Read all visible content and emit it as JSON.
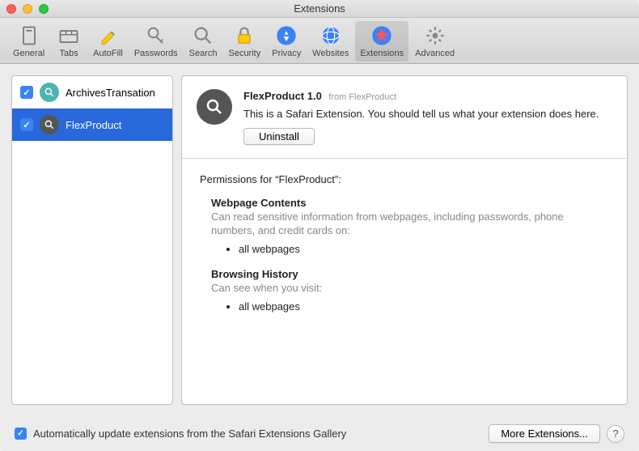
{
  "window": {
    "title": "Extensions"
  },
  "toolbar": {
    "items": [
      {
        "label": "General"
      },
      {
        "label": "Tabs"
      },
      {
        "label": "AutoFill"
      },
      {
        "label": "Passwords"
      },
      {
        "label": "Search"
      },
      {
        "label": "Security"
      },
      {
        "label": "Privacy"
      },
      {
        "label": "Websites"
      },
      {
        "label": "Extensions"
      },
      {
        "label": "Advanced"
      }
    ]
  },
  "sidebar": {
    "items": [
      {
        "label": "ArchivesTransation",
        "checked": true
      },
      {
        "label": "FlexProduct",
        "checked": true,
        "selected": true
      }
    ]
  },
  "detail": {
    "title": "FlexProduct 1.0",
    "from": "from FlexProduct",
    "description": "This is a Safari Extension. You should tell us what your extension does here.",
    "uninstall_label": "Uninstall"
  },
  "permissions": {
    "heading": "Permissions for “FlexProduct”:",
    "sections": [
      {
        "title": "Webpage Contents",
        "desc": "Can read sensitive information from webpages, including passwords, phone numbers, and credit cards on:",
        "items": [
          "all webpages"
        ]
      },
      {
        "title": "Browsing History",
        "desc": "Can see when you visit:",
        "items": [
          "all webpages"
        ]
      }
    ]
  },
  "footer": {
    "auto_update_label": "Automatically update extensions from the Safari Extensions Gallery",
    "more_label": "More Extensions...",
    "help_label": "?"
  }
}
